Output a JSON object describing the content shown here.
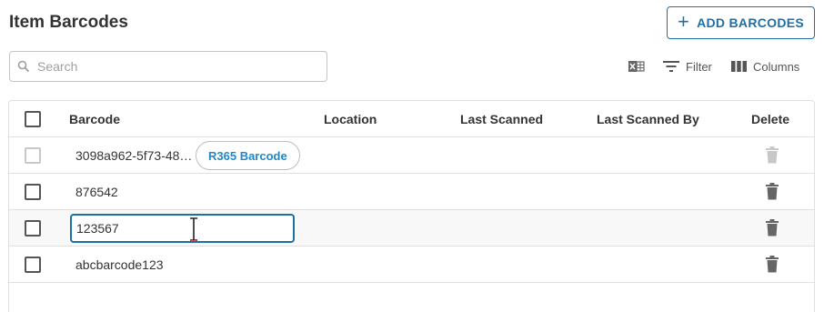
{
  "page": {
    "title": "Item Barcodes"
  },
  "actions": {
    "add_label": "ADD BARCODES"
  },
  "search": {
    "placeholder": "Search",
    "value": ""
  },
  "toolbar": {
    "filter_label": "Filter",
    "columns_label": "Columns",
    "export_icon": "excel-export-icon"
  },
  "table": {
    "columns": [
      "Barcode",
      "Location",
      "Last Scanned",
      "Last Scanned By",
      "Delete"
    ],
    "rows": [
      {
        "barcode": "3098a962-5f73-48…",
        "badge": "R365 Barcode",
        "checkbox_enabled": false,
        "delete_enabled": false
      },
      {
        "barcode": "876542",
        "checkbox_enabled": true,
        "delete_enabled": true
      },
      {
        "barcode": "123567",
        "editing": true,
        "checkbox_enabled": true,
        "delete_enabled": true
      },
      {
        "barcode": "abcbarcode123",
        "checkbox_enabled": true,
        "delete_enabled": true
      }
    ]
  },
  "colors": {
    "accent": "#1e6fa3",
    "badge_text": "#1e88c8",
    "border": "#e0e0e0"
  }
}
